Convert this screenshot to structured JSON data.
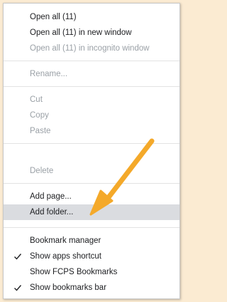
{
  "menu": {
    "open_all": "Open all (11)",
    "open_all_new_window": "Open all (11) in new window",
    "open_all_incognito": "Open all (11) in incognito window",
    "rename": "Rename...",
    "cut": "Cut",
    "copy": "Copy",
    "paste": "Paste",
    "delete": "Delete",
    "add_page": "Add page...",
    "add_folder": "Add folder...",
    "bookmark_manager": "Bookmark manager",
    "show_apps_shortcut": "Show apps shortcut",
    "show_fcps_bookmarks": "Show FCPS Bookmarks",
    "show_bookmarks_bar": "Show bookmarks bar"
  },
  "checked": {
    "show_apps_shortcut": true,
    "show_bookmarks_bar": true
  },
  "colors": {
    "background": "#fbebd2",
    "highlight": "#dadce0",
    "arrow": "#f4a92a"
  },
  "icons": {
    "check": "check-icon",
    "annotation": "arrow-annotation"
  }
}
